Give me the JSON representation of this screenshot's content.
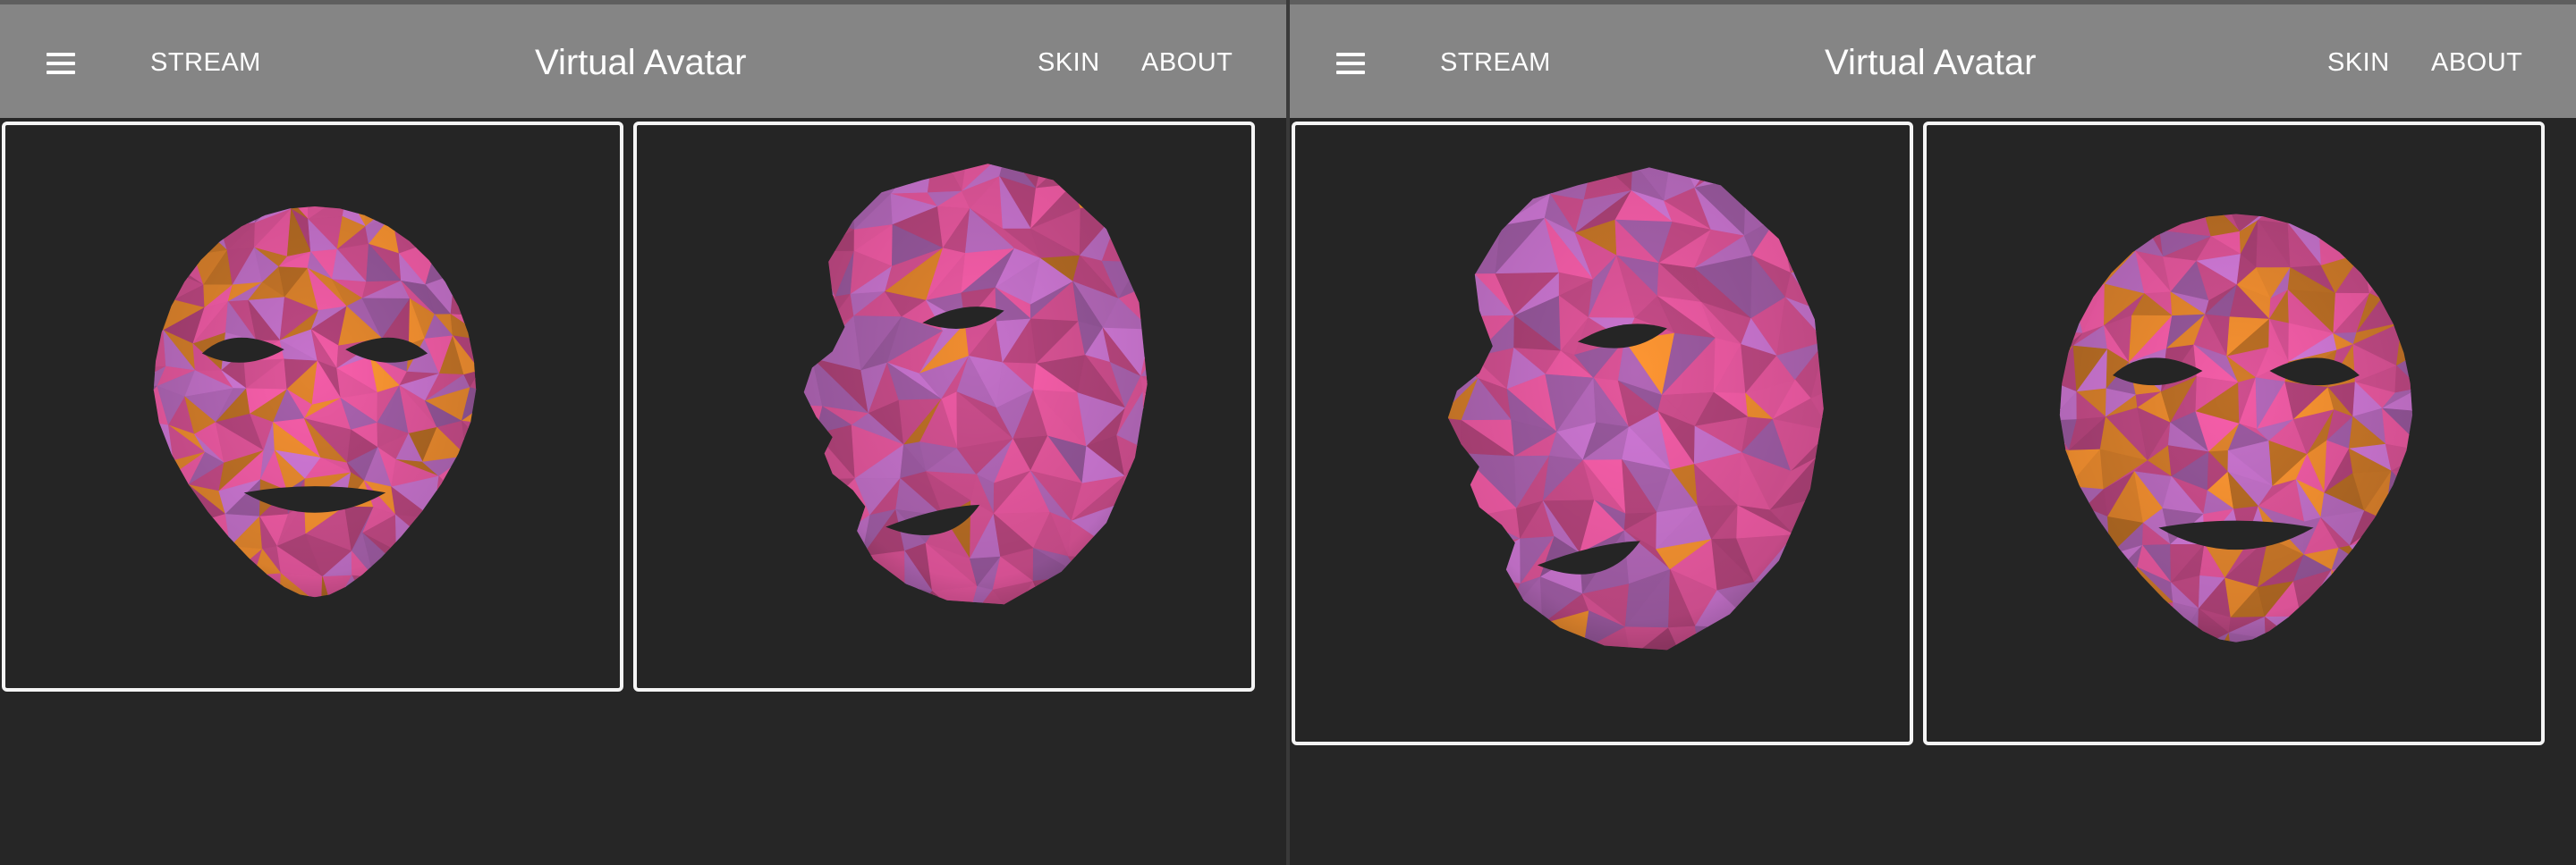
{
  "screens": [
    {
      "appbar": {
        "title": "Virtual Avatar",
        "nav_stream": "STREAM",
        "nav_skin": "SKIN",
        "nav_about": "ABOUT",
        "menu_icon": "hamburger-menu-icon"
      },
      "views": [
        {
          "view": "front",
          "icon": "face-mask-front"
        },
        {
          "view": "side",
          "icon": "face-mask-side"
        }
      ]
    },
    {
      "appbar": {
        "title": "Virtual Avatar",
        "nav_stream": "STREAM",
        "nav_skin": "SKIN",
        "nav_about": "ABOUT",
        "menu_icon": "hamburger-menu-icon"
      },
      "views": [
        {
          "view": "side",
          "icon": "face-mask-side"
        },
        {
          "view": "front",
          "icon": "face-mask-front"
        }
      ]
    }
  ],
  "colors": {
    "appbar_bg": "#858585",
    "canvas_bg": "#252525",
    "panel_border": "#f4f4f4",
    "mask_pink": "#e0559a",
    "mask_violet": "#c06fc6",
    "mask_orange": "#e8892e"
  }
}
